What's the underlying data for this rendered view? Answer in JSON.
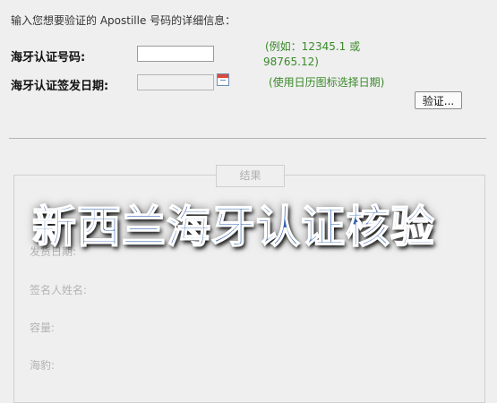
{
  "form": {
    "intro": "输入您想要验证的 Apostille 号码的详细信息：",
    "number_label": "海牙认证号码:",
    "number_value": "",
    "number_hint_line1": "(例如：12345.1 或",
    "number_hint_line2": "98765.12)",
    "date_label": "海牙认证签发日期:",
    "date_value": "",
    "date_hint": "(使用日历图标选择日期)",
    "calendar_icon": "calendar-icon",
    "verify_button": "验证..."
  },
  "results": {
    "legend": "结果",
    "fields": [
      "发货日期:",
      "签名人姓名:",
      "容量:",
      "海豹:"
    ]
  },
  "overlay": {
    "text": "新西兰海牙认证核验",
    "color": "#2e5fae"
  }
}
